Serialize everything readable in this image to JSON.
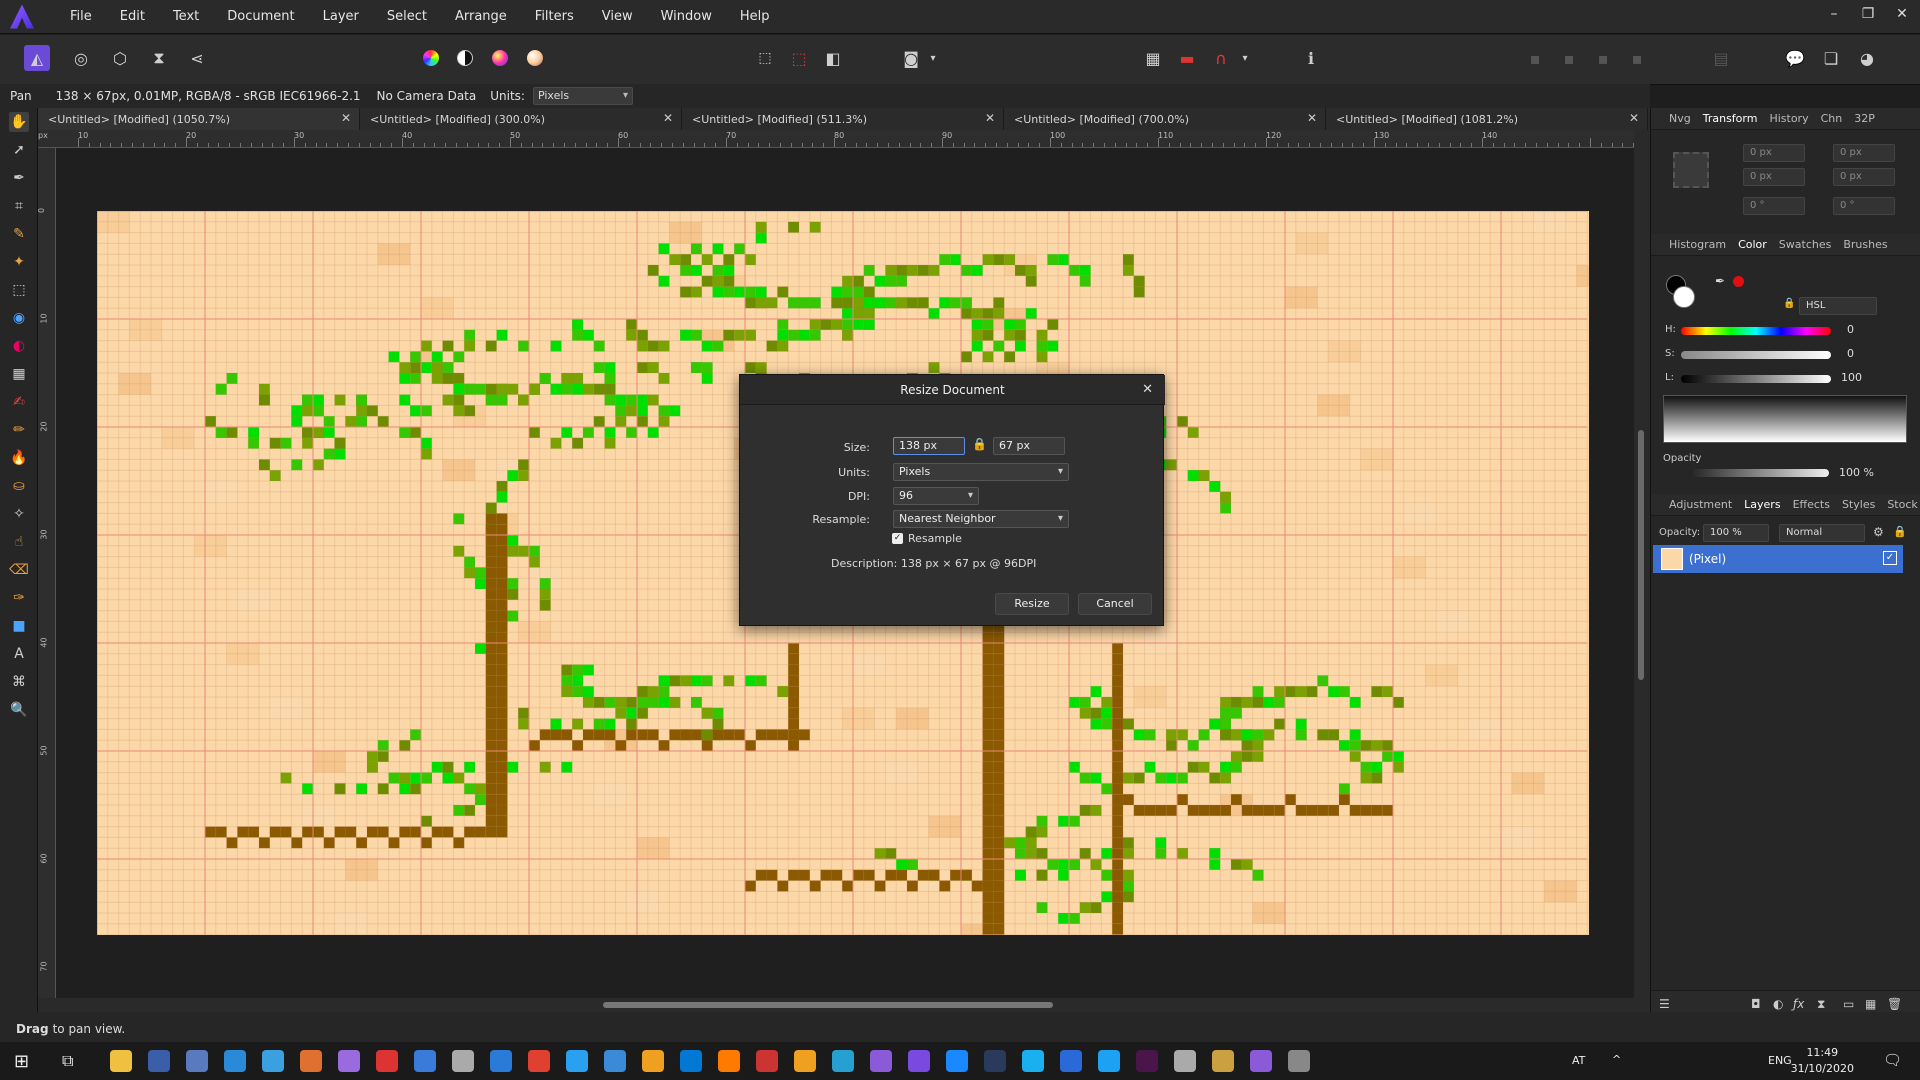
{
  "menu": [
    "File",
    "Edit",
    "Text",
    "Document",
    "Layer",
    "Select",
    "Arrange",
    "Filters",
    "View",
    "Window",
    "Help"
  ],
  "window_controls": [
    "–",
    "❐",
    "✕"
  ],
  "context": {
    "tool": "Pan",
    "info": "138 × 67px, 0.01MP, RGBA/8 - sRGB IEC61966-2.1",
    "camera": "No Camera Data",
    "units_label": "Units:",
    "units_value": "Pixels"
  },
  "tabs": [
    {
      "label": "<Untitled> [Modified] (1050.7%)"
    },
    {
      "label": "<Untitled> [Modified] (300.0%)"
    },
    {
      "label": "<Untitled> [Modified] (511.3%)"
    },
    {
      "label": "<Untitled> [Modified] (700.0%)"
    },
    {
      "label": "<Untitled> [Modified] (1081.2%)"
    }
  ],
  "ruler_h_labels": [
    "px",
    "10",
    "20",
    "30",
    "40",
    "50",
    "60",
    "70",
    "80",
    "90",
    "100",
    "110",
    "120",
    "130",
    "140"
  ],
  "ruler_v_labels": [
    "0",
    "10",
    "20",
    "30",
    "40",
    "50",
    "60",
    "70"
  ],
  "dialog": {
    "title": "Resize Document",
    "size_label": "Size:",
    "width": "138 px",
    "height": "67 px",
    "units_label": "Units:",
    "units": "Pixels",
    "dpi_label": "DPI:",
    "dpi": "96",
    "resample_label": "Resample:",
    "resample_method": "Nearest Neighbor",
    "resample_checkbox": "Resample",
    "description_label": "Description:",
    "description": "138 px × 67 px @ 96DPI",
    "resize_button": "Resize",
    "cancel_button": "Cancel"
  },
  "panels": {
    "top_tabs": [
      "Nvg",
      "Transform",
      "History",
      "Chn",
      "32P"
    ],
    "transform_fields": [
      "0 px",
      "0 px",
      "0 px",
      "0 px",
      "0 °",
      "0 °"
    ],
    "color_tabs": [
      "Histogram",
      "Color",
      "Swatches",
      "Brushes"
    ],
    "color_model": "HSL",
    "hsl": [
      {
        "label": "H:",
        "value": "0"
      },
      {
        "label": "S:",
        "value": "0"
      },
      {
        "label": "L:",
        "value": "100"
      }
    ],
    "opacity_label": "Opacity",
    "opacity_value": "100 %",
    "layer_tabs": [
      "Adjustment",
      "Layers",
      "Effects",
      "Styles",
      "Stock"
    ],
    "layers_opacity_label": "Opacity:",
    "layers_opacity_value": "100 %",
    "blend_mode": "Normal",
    "layer_name": "(Pixel)"
  },
  "status": {
    "bold": "Drag",
    "text": "to pan view."
  },
  "taskbar": {
    "lang_region": "AT",
    "lang": "ENG",
    "time": "11:49",
    "date": "31/10/2020"
  },
  "colors": {
    "accent": "#3b6fd0",
    "canvas_bg": "#fcd7a8",
    "tree_trunk": "#8b5a00",
    "leaf_bright": "#00e000",
    "leaf_olive": "#6e8c00"
  }
}
